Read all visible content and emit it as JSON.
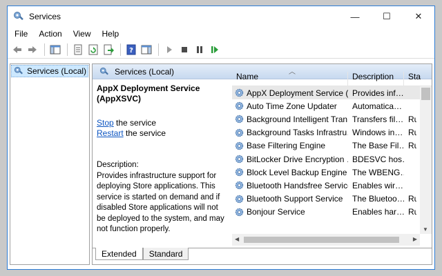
{
  "window": {
    "title": "Services",
    "controls": {
      "minimize": "—",
      "maximize": "☐",
      "close": "✕"
    }
  },
  "menu": [
    "File",
    "Action",
    "View",
    "Help"
  ],
  "tree": {
    "root_label": "Services (Local)"
  },
  "pane": {
    "header": "Services (Local)",
    "details": {
      "title": "AppX Deployment Service (AppXSVC)",
      "stop_link": "Stop",
      "stop_suffix": " the service",
      "restart_link": "Restart",
      "restart_suffix": " the service",
      "description_label": "Description:",
      "description_text": "Provides infrastructure support for deploying Store applications. This service is started on demand and if disabled Store applications will not be deployed to the system, and may not function properly."
    },
    "columns": {
      "name": "Name",
      "description": "Description",
      "status": "Sta"
    },
    "rows": [
      {
        "name": "AppX Deployment Service (…",
        "description": "Provides inf…",
        "status": ""
      },
      {
        "name": "Auto Time Zone Updater",
        "description": "Automatica…",
        "status": ""
      },
      {
        "name": "Background Intelligent Tran…",
        "description": "Transfers fil…",
        "status": "Rur"
      },
      {
        "name": "Background Tasks Infrastru…",
        "description": "Windows in…",
        "status": "Rur"
      },
      {
        "name": "Base Filtering Engine",
        "description": "The Base Fil…",
        "status": "Rur"
      },
      {
        "name": "BitLocker Drive Encryption …",
        "description": "BDESVC hos…",
        "status": ""
      },
      {
        "name": "Block Level Backup Engine …",
        "description": "The WBENG…",
        "status": ""
      },
      {
        "name": "Bluetooth Handsfree Service",
        "description": "Enables wir…",
        "status": ""
      },
      {
        "name": "Bluetooth Support Service",
        "description": "The Bluetoo…",
        "status": "Rur"
      },
      {
        "name": "Bonjour Service",
        "description": "Enables har…",
        "status": "Rur"
      }
    ],
    "tabs": {
      "extended": "Extended",
      "standard": "Standard"
    }
  },
  "colors": {
    "accent": "#2b7bd6",
    "link": "#0b54c1",
    "selected_tree": "#cce8ff",
    "play_green": "#2a9d3a"
  }
}
